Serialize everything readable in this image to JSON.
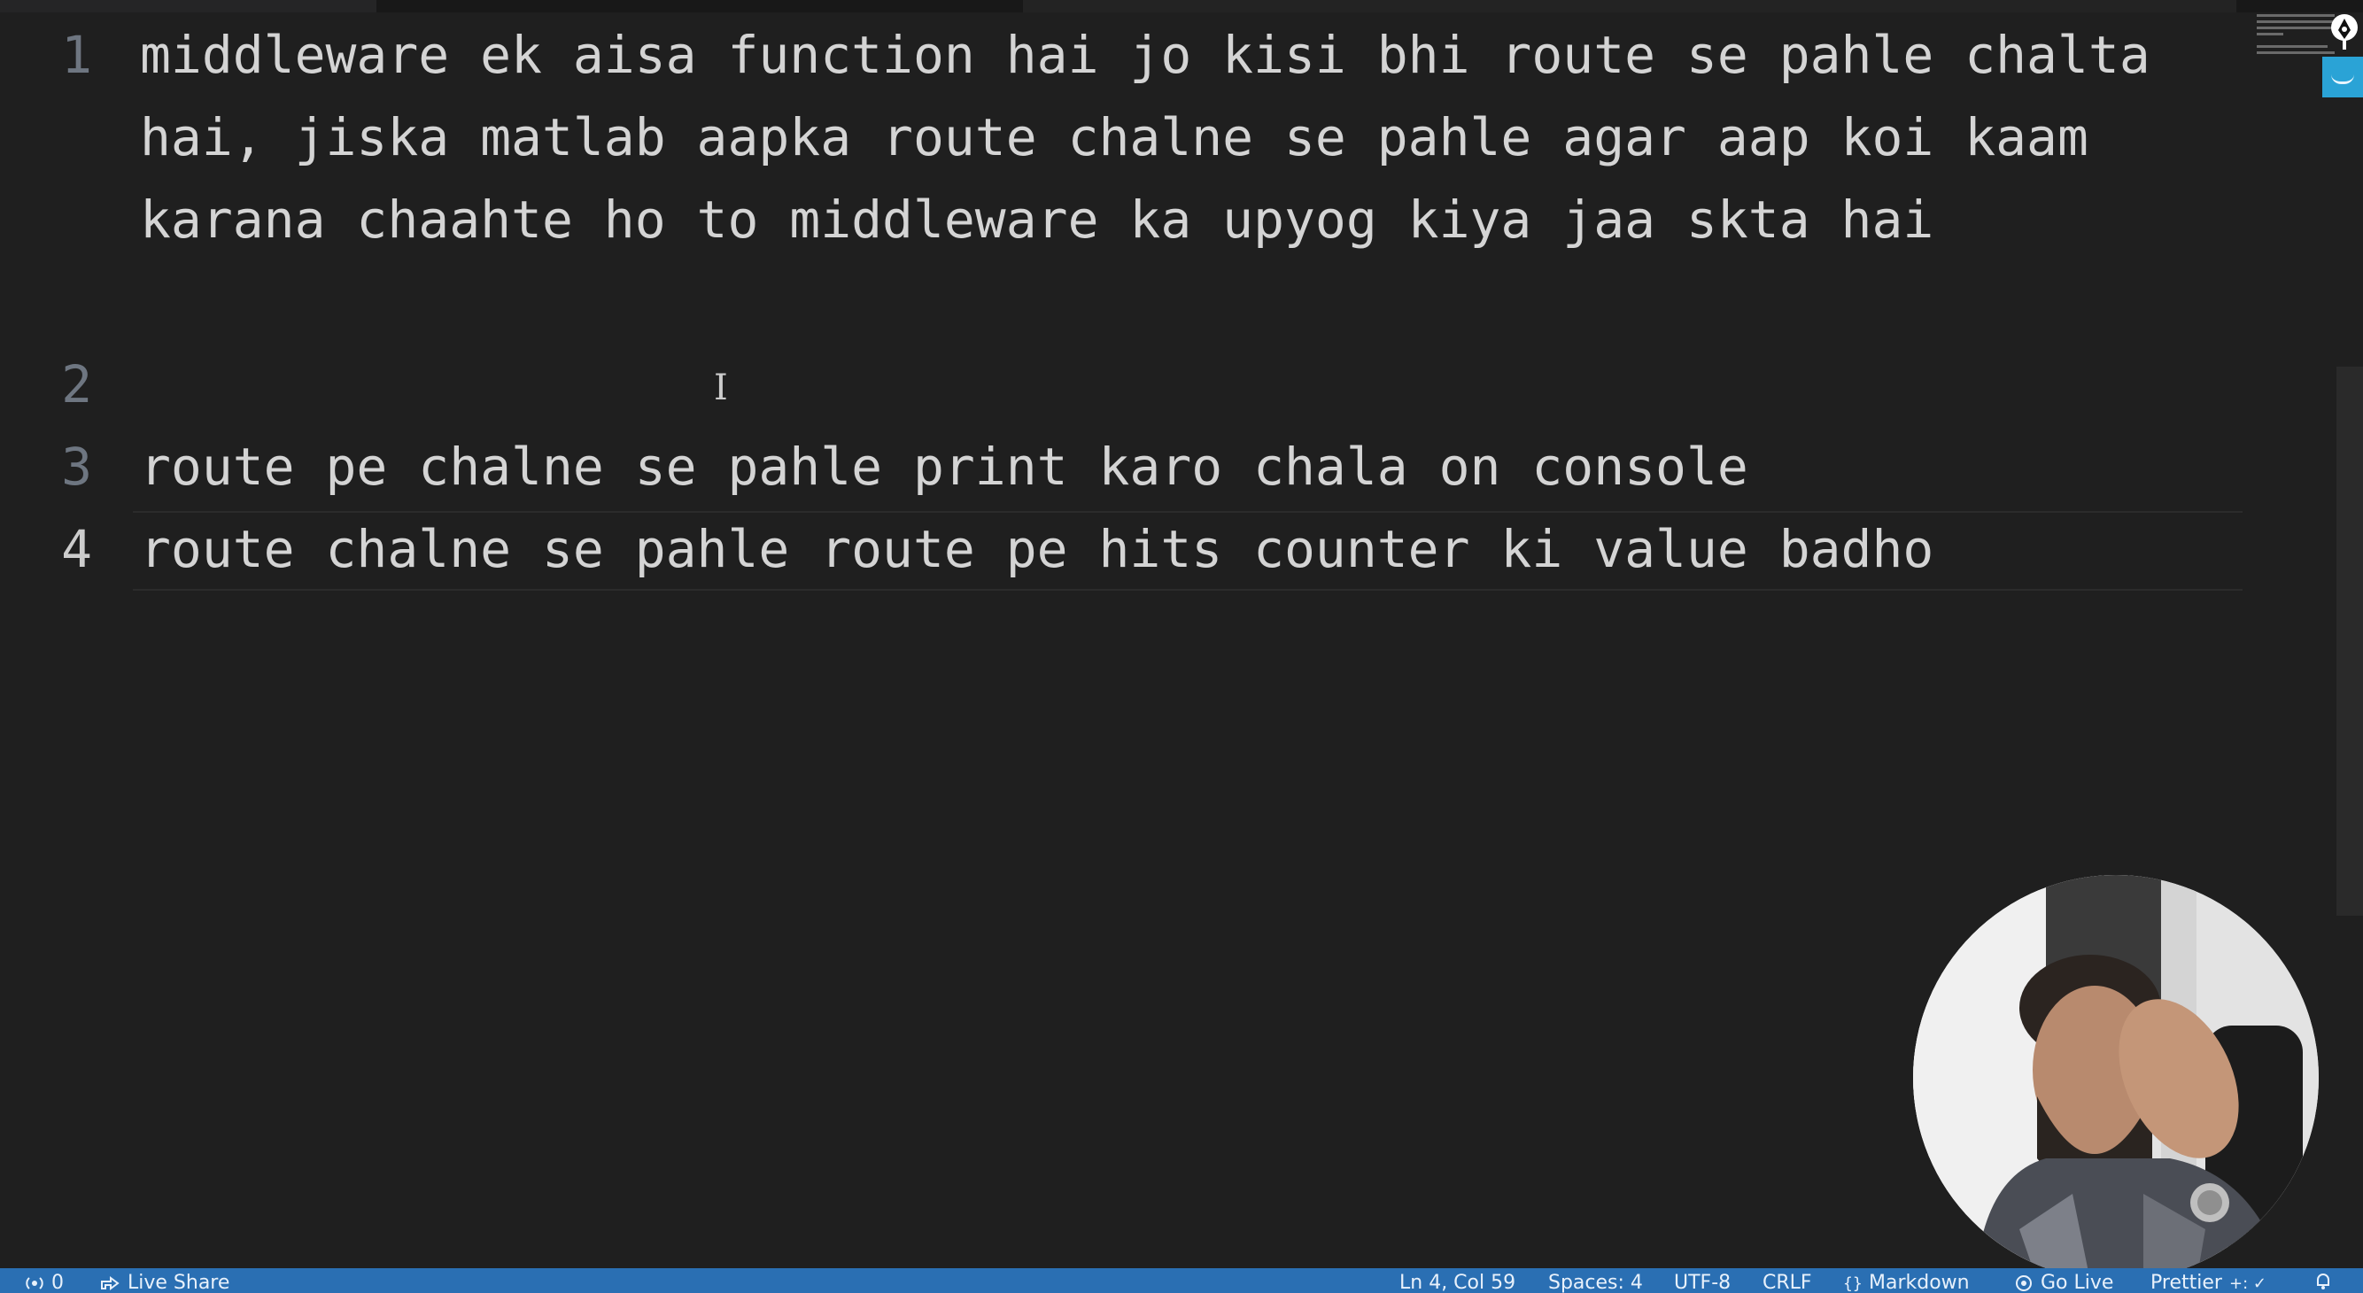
{
  "editor": {
    "lines": [
      {
        "number": "1",
        "text": "middleware ek aisa function hai jo kisi bhi route se pahle chalta hai, jiska matlab aapka route chalne se pahle agar aap koi kaam karana chaahte ho to middleware ka upyog kiya jaa skta hai"
      },
      {
        "number": "2",
        "text": ""
      },
      {
        "number": "3",
        "text": "route pe chalne se pahle print karo chala on console"
      },
      {
        "number": "4",
        "text": "route chalne se pahle route pe hits counter ki value badho"
      }
    ],
    "active_line": "4"
  },
  "status_bar": {
    "ports": "0",
    "live_share": "Live Share",
    "cursor_position": "Ln 4, Col 59",
    "indentation": "Spaces: 4",
    "encoding": "UTF-8",
    "line_ending": "CRLF",
    "language": "Markdown",
    "go_live": "Go Live",
    "prettier": "Prettier"
  },
  "icons": {
    "ports": "broadcast-icon",
    "live_share": "live-share-icon",
    "language": "braces-icon",
    "go_live": "go-live-icon",
    "prettier": "check-icon",
    "notifications": "bell-icon",
    "minimap_tool": "pen-icon"
  },
  "colors": {
    "editor_background": "#1f1f1f",
    "text": "#d4d4d4",
    "line_number": "#6e7681",
    "status_bar": "#2a6fb3",
    "scroll_accent": "#2aa3d6"
  }
}
